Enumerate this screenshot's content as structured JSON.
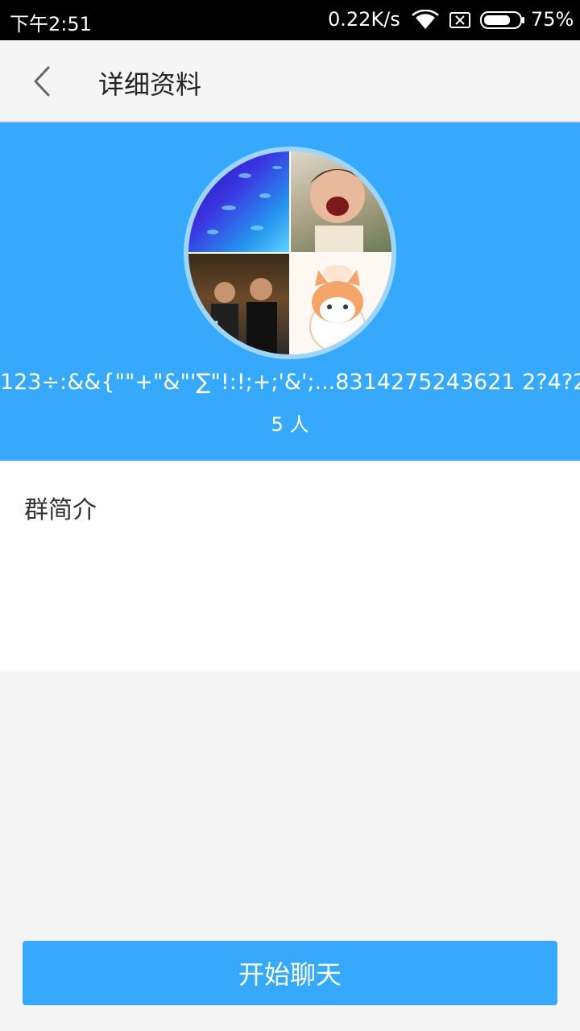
{
  "status_bar": {
    "time": "下午2:51",
    "network_speed": "0.22K/s",
    "battery": "75%",
    "icons": [
      "wifi-icon",
      "no-sim-icon",
      "battery-icon"
    ]
  },
  "header": {
    "title": "详细资料",
    "back_icon": "chevron-left-icon"
  },
  "profile": {
    "group_name": "123÷:&&{\"\"+\"&\"'∑\"!:!;+;'&';...8314275243621 2?4?2",
    "member_count": "5 人",
    "avatar_tiles": [
      "blue-fish-photo",
      "child-photo",
      "group-photo",
      "cartoon-cat-photo"
    ]
  },
  "intro": {
    "label": "群简介"
  },
  "actions": {
    "start_chat_label": "开始聊天"
  },
  "colors": {
    "accent": "#36a9fd",
    "header_bg": "#f5f5f5",
    "page_bg": "#f4f4f4"
  }
}
